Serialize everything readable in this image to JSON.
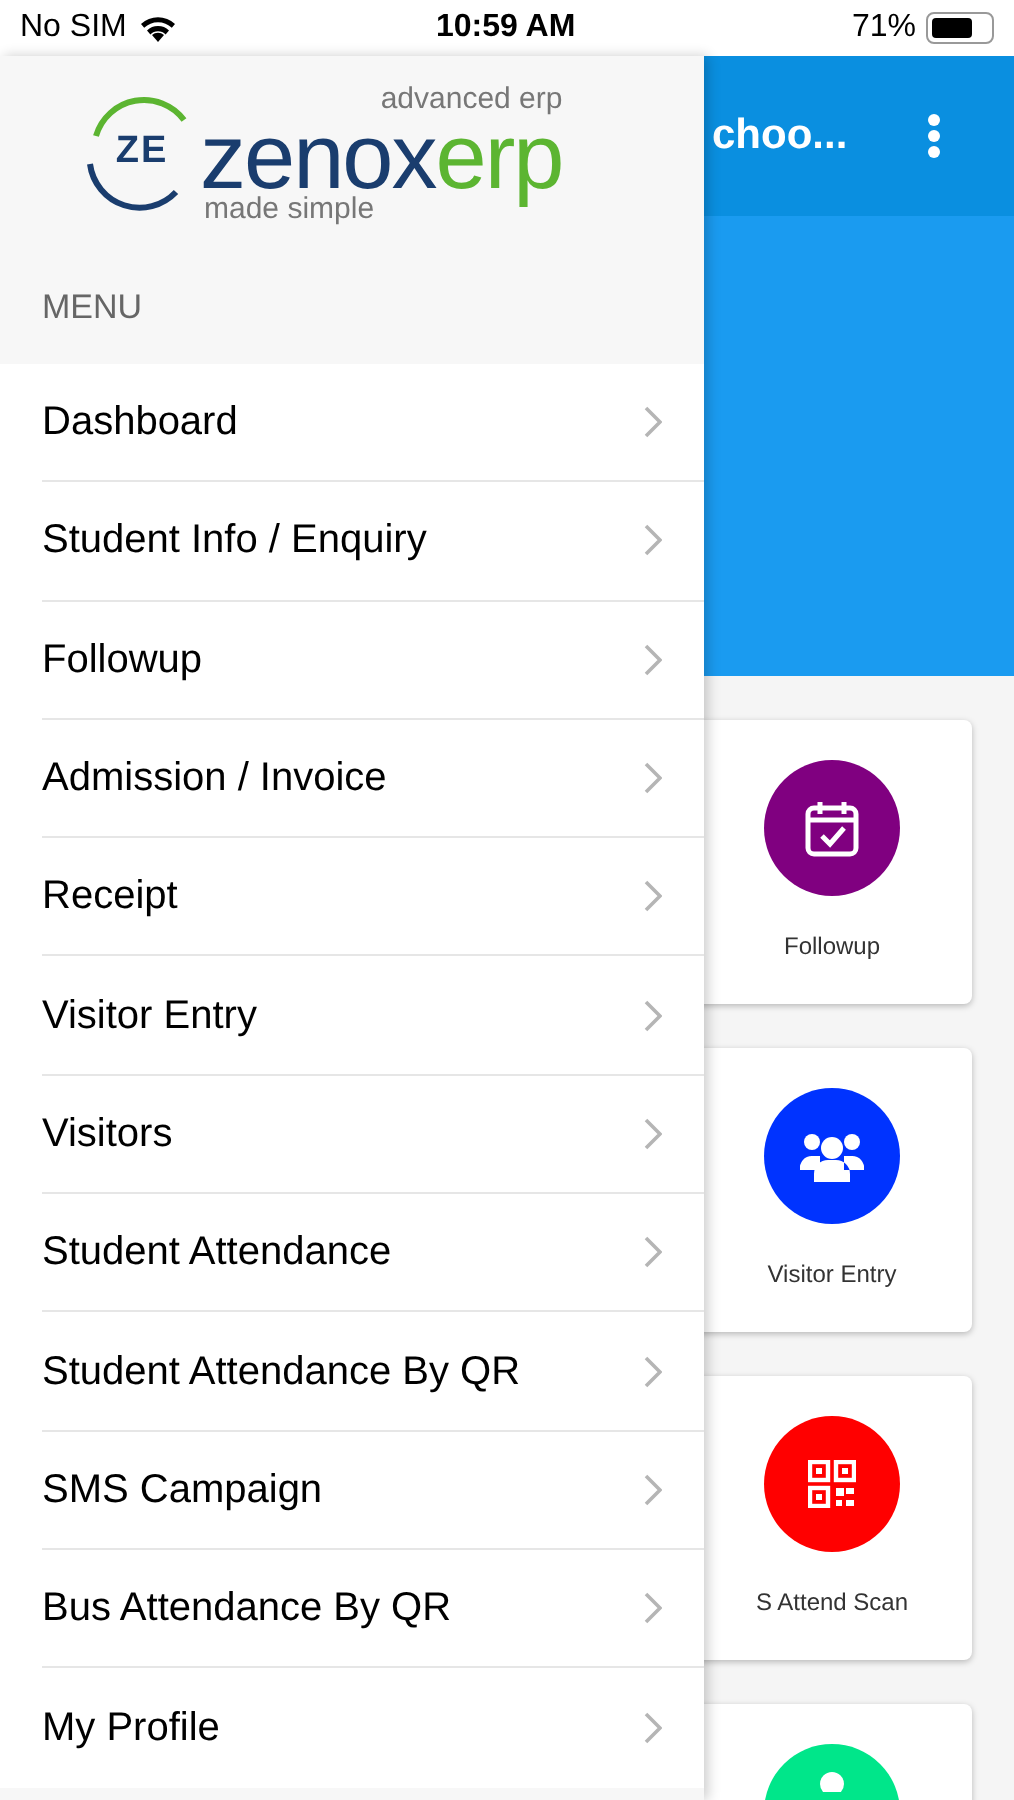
{
  "status_bar": {
    "carrier": "No SIM",
    "time": "10:59 AM",
    "battery": "71%"
  },
  "app_bar": {
    "title": "choo..."
  },
  "cards": [
    {
      "label": "Followup",
      "color": "#800080",
      "kind": "calendar"
    },
    {
      "label": "Visitor Entry",
      "color": "#0033ff",
      "kind": "people"
    },
    {
      "label": "S Attend Scan",
      "color": "#ff0000",
      "kind": "qr"
    },
    {
      "color": "#00e68a",
      "kind": "partial"
    }
  ],
  "drawer": {
    "logo": {
      "mark": "ZE",
      "name": "zenox",
      "suffix": "erp",
      "tagline_top": "advanced erp",
      "tagline_bottom": "made simple"
    },
    "section": "MENU",
    "items": [
      {
        "label": "Dashboard"
      },
      {
        "label": "Student Info / Enquiry"
      },
      {
        "label": "Followup"
      },
      {
        "label": "Admission / Invoice"
      },
      {
        "label": "Receipt"
      },
      {
        "label": "Visitor Entry"
      },
      {
        "label": "Visitors"
      },
      {
        "label": "Student Attendance"
      },
      {
        "label": "Student Attendance By QR"
      },
      {
        "label": "SMS Campaign"
      },
      {
        "label": "Bus Attendance By QR"
      },
      {
        "label": "My Profile"
      }
    ]
  }
}
